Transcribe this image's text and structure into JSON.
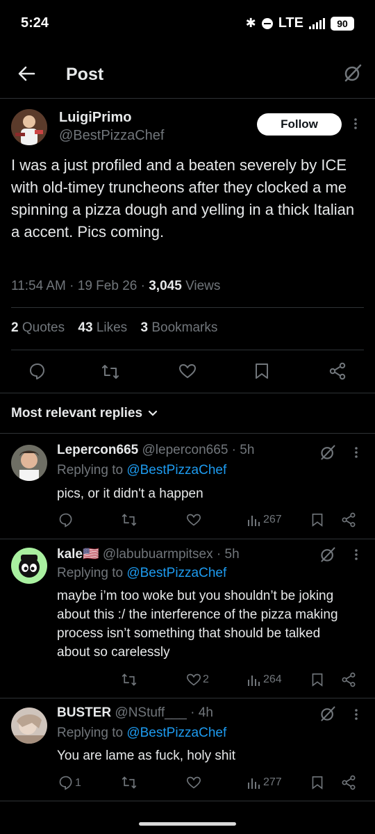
{
  "status_bar": {
    "time": "5:24",
    "network": "LTE",
    "battery": "90"
  },
  "header": {
    "title": "Post"
  },
  "post": {
    "display_name": "LuigiPrimo",
    "handle": "@BestPizzaChef",
    "follow_label": "Follow",
    "text": "I was a just profiled and a beaten severely by ICE with old-timey truncheons after they clocked a me spinning a pizza dough and yelling in a thick Italian a accent. Pics coming.",
    "time": "11:54 AM",
    "date": "19 Feb 26",
    "views_count": "3,045",
    "views_label": "Views",
    "quotes_count": "2",
    "quotes_label": "Quotes",
    "likes_count": "43",
    "likes_label": "Likes",
    "bookmarks_count": "3",
    "bookmarks_label": "Bookmarks"
  },
  "replies_header": "Most relevant replies",
  "replies": [
    {
      "name": "Lepercon665",
      "handle": "@lepercon665",
      "time": "5h",
      "replying_prefix": "Replying to",
      "replying_to": "@BestPizzaChef",
      "text": "pics, or it didn't a happen",
      "reply_count": "",
      "like_count": "",
      "views": "267"
    },
    {
      "name": "kale🇺🇸",
      "handle": "@labubuarmpitsex",
      "time": "5h",
      "replying_prefix": "Replying to",
      "replying_to": "@BestPizzaChef",
      "text": "maybe i’m too woke but you shouldn’t be joking about this :/ the interference of the pizza making process isn’t something that should be talked about so carelessly",
      "reply_count": "",
      "like_count": "2",
      "views": "264"
    },
    {
      "name": "BUSTER",
      "handle": "@NStuff___",
      "time": "4h",
      "replying_prefix": "Replying to",
      "replying_to": "@BestPizzaChef",
      "text": "You are lame as fuck, holy shit",
      "reply_count": "1",
      "like_count": "",
      "views": "277"
    }
  ],
  "colors": {
    "background": "#000000",
    "text": "#e7e9ea",
    "muted": "#71767b",
    "link": "#1d9bf0",
    "divider": "#2f3336"
  },
  "icons": [
    "back-arrow-icon",
    "grok-icon",
    "more-icon",
    "reply-icon",
    "repost-icon",
    "like-icon",
    "bookmark-icon",
    "share-icon",
    "views-icon",
    "chevron-down-icon"
  ]
}
